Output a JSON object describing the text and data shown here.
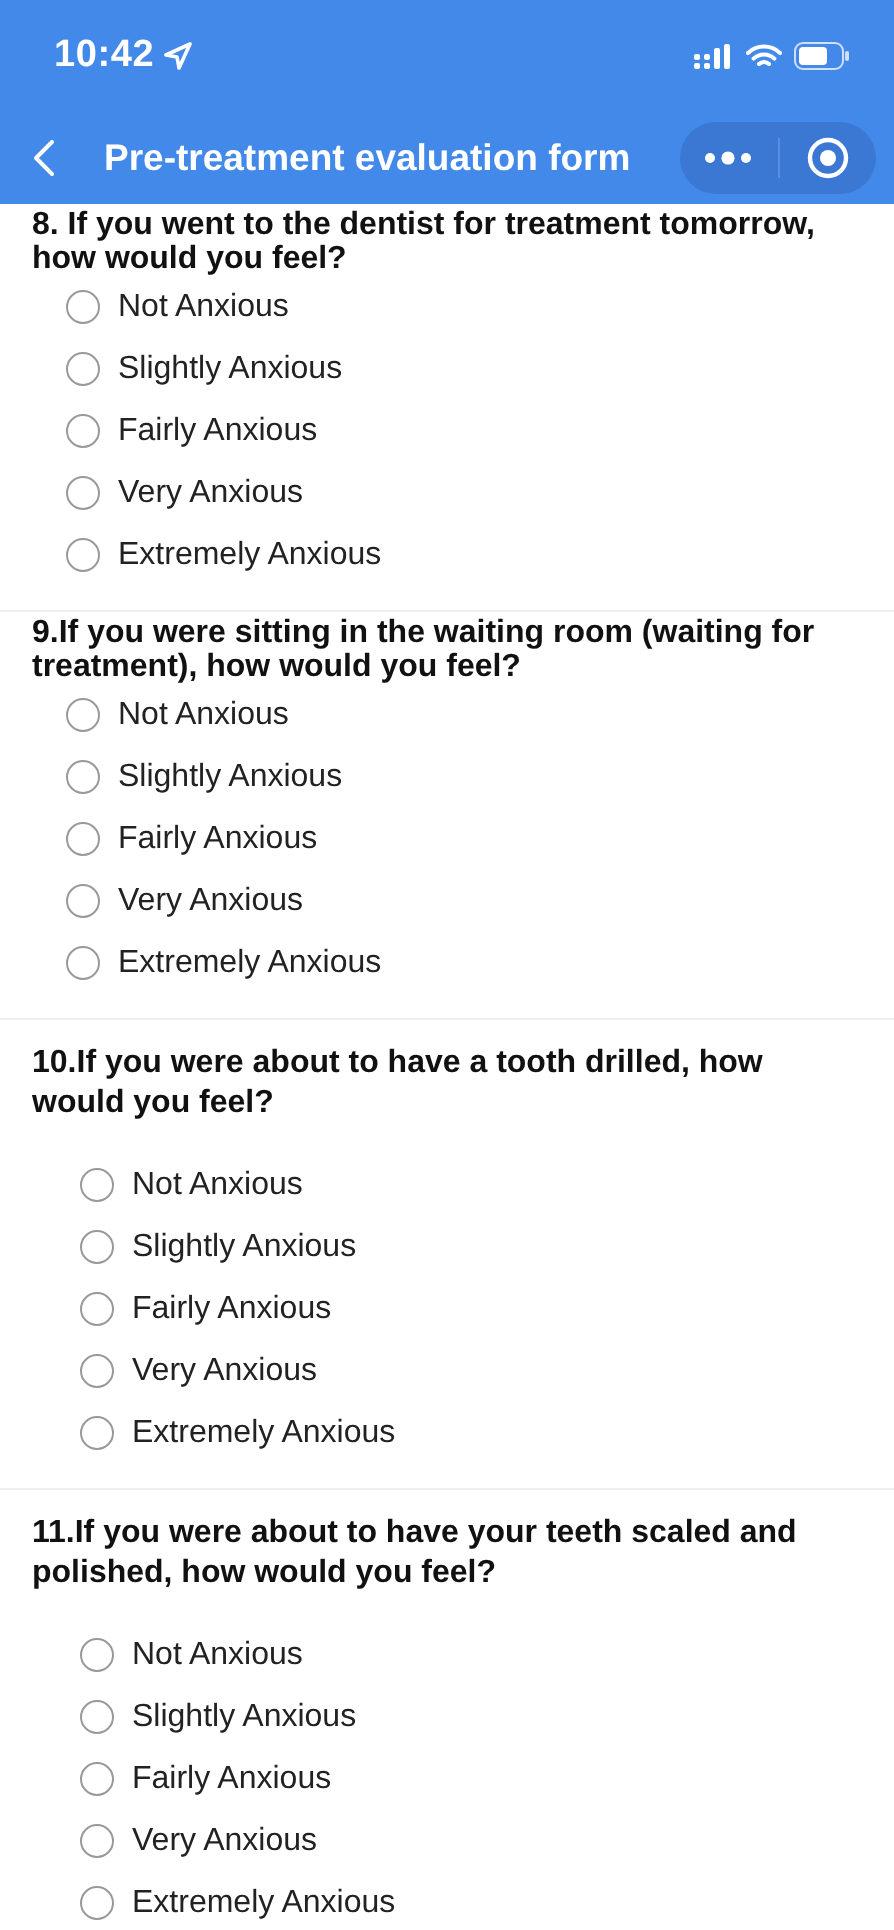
{
  "status_bar": {
    "time": "10:42"
  },
  "nav": {
    "title": "Pre-treatment evaluation form"
  },
  "questions": [
    {
      "kind": "compact",
      "text": "8. If you went to the dentist for treatment tomorrow, how would you feel?",
      "options": [
        {
          "label": "Not Anxious",
          "selected": false
        },
        {
          "label": "Slightly Anxious",
          "selected": false
        },
        {
          "label": "Fairly Anxious",
          "selected": false
        },
        {
          "label": "Very Anxious",
          "selected": false
        },
        {
          "label": "Extremely Anxious",
          "selected": false
        }
      ]
    },
    {
      "kind": "compact",
      "text": "9.If you were sitting in the waiting room (waiting for treatment), how would you feel?",
      "options": [
        {
          "label": "Not Anxious",
          "selected": false
        },
        {
          "label": "Slightly Anxious",
          "selected": false
        },
        {
          "label": "Fairly Anxious",
          "selected": false
        },
        {
          "label": "Very Anxious",
          "selected": false
        },
        {
          "label": "Extremely Anxious",
          "selected": false
        }
      ]
    },
    {
      "kind": "spaced",
      "text": "10.If you were about to have a tooth drilled, how would you feel?",
      "options": [
        {
          "label": "Not Anxious",
          "selected": false
        },
        {
          "label": "Slightly Anxious",
          "selected": false
        },
        {
          "label": "Fairly Anxious",
          "selected": false
        },
        {
          "label": "Very Anxious",
          "selected": false
        },
        {
          "label": "Extremely Anxious",
          "selected": false
        }
      ]
    },
    {
      "kind": "spaced",
      "text": "11.If you were about to have your teeth scaled and polished, how would you feel?",
      "options": [
        {
          "label": "Not Anxious",
          "selected": false
        },
        {
          "label": "Slightly Anxious",
          "selected": false
        },
        {
          "label": "Fairly Anxious",
          "selected": false
        },
        {
          "label": "Very Anxious",
          "selected": false
        },
        {
          "label": "Extremely Anxious",
          "selected": false
        }
      ]
    }
  ]
}
